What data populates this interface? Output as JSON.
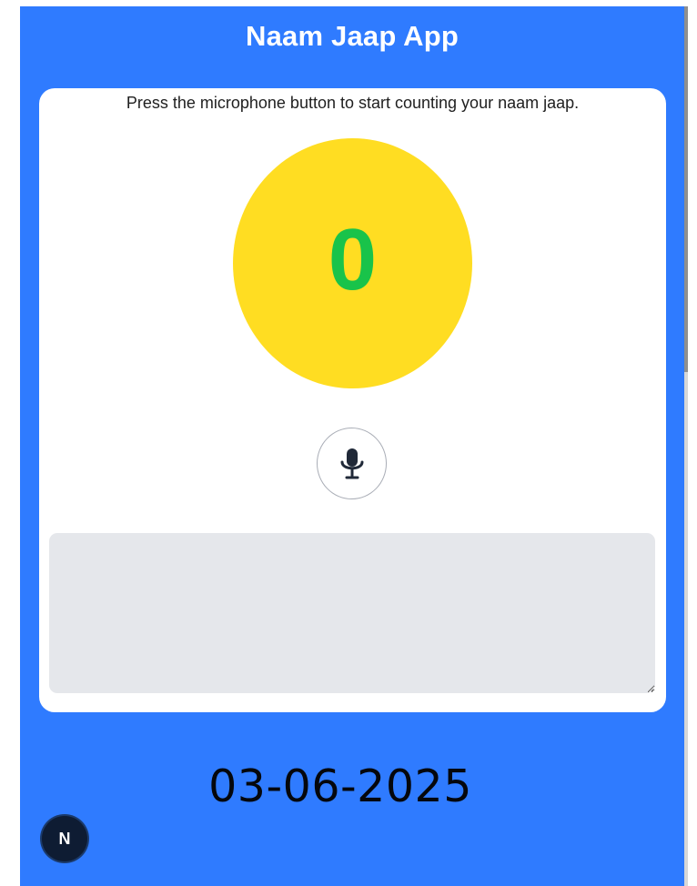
{
  "app": {
    "title": "Naam Jaap App"
  },
  "card": {
    "instruction": "Press the microphone button to start counting your naam jaap.",
    "counter": "0",
    "mic_icon": "microphone-icon",
    "transcript": {
      "value": "",
      "placeholder": ""
    }
  },
  "footer": {
    "date": "03-06-2025",
    "badge_letter": "N"
  },
  "colors": {
    "background": "#2f7bff",
    "card": "#ffffff",
    "counter_circle": "#ffdd22",
    "counter_text": "#19c34a",
    "textarea": "#e5e7eb",
    "badge": "#0e1c33"
  }
}
